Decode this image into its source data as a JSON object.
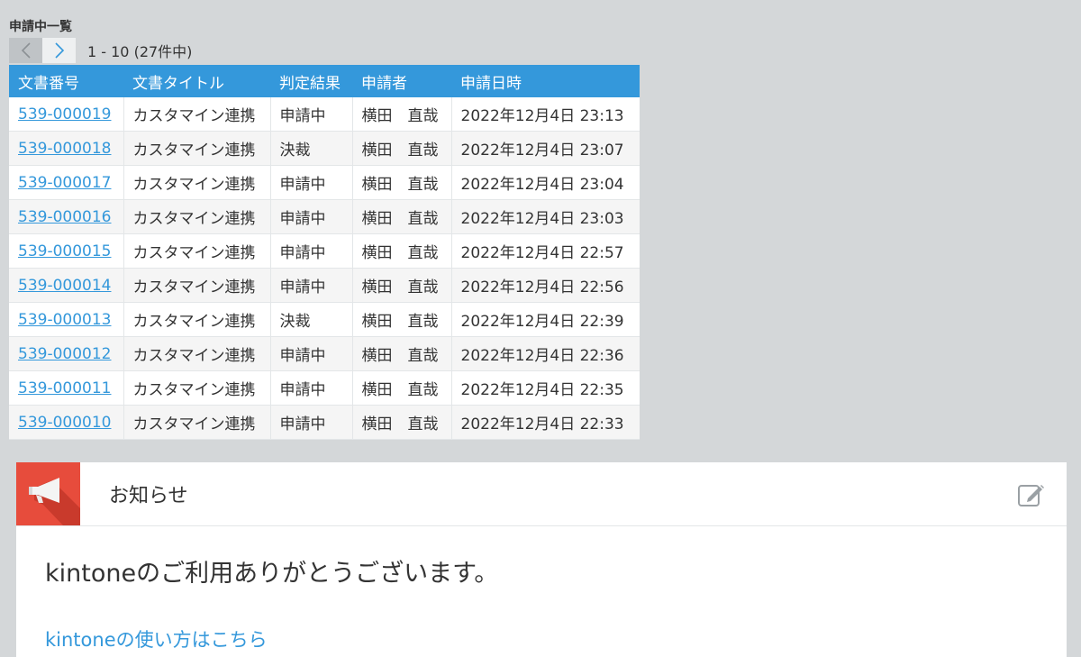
{
  "list": {
    "title": "申請中一覧",
    "pager": {
      "prev_icon": "chevron-left-icon",
      "next_icon": "chevron-right-icon",
      "range": "1 - 10 (27件中)"
    },
    "columns": [
      "文書番号",
      "文書タイトル",
      "判定結果",
      "申請者",
      "申請日時"
    ],
    "rows": [
      [
        "539-000019",
        "カスタマイン連携",
        "申請中",
        "横田　直哉",
        "2022年12月4日 23:13"
      ],
      [
        "539-000018",
        "カスタマイン連携",
        "決裁",
        "横田　直哉",
        "2022年12月4日 23:07"
      ],
      [
        "539-000017",
        "カスタマイン連携",
        "申請中",
        "横田　直哉",
        "2022年12月4日 23:04"
      ],
      [
        "539-000016",
        "カスタマイン連携",
        "申請中",
        "横田　直哉",
        "2022年12月4日 23:03"
      ],
      [
        "539-000015",
        "カスタマイン連携",
        "申請中",
        "横田　直哉",
        "2022年12月4日 22:57"
      ],
      [
        "539-000014",
        "カスタマイン連携",
        "申請中",
        "横田　直哉",
        "2022年12月4日 22:56"
      ],
      [
        "539-000013",
        "カスタマイン連携",
        "決裁",
        "横田　直哉",
        "2022年12月4日 22:39"
      ],
      [
        "539-000012",
        "カスタマイン連携",
        "申請中",
        "横田　直哉",
        "2022年12月4日 22:36"
      ],
      [
        "539-000011",
        "カスタマイン連携",
        "申請中",
        "横田　直哉",
        "2022年12月4日 22:35"
      ],
      [
        "539-000010",
        "カスタマイン連携",
        "申請中",
        "横田　直哉",
        "2022年12月4日 22:33"
      ]
    ]
  },
  "notice": {
    "icon": "megaphone-icon",
    "title": "お知らせ",
    "edit_icon": "edit-icon",
    "message": "kintoneのご利用ありがとうございます。",
    "link": "kintoneの使い方はこちら"
  },
  "colors": {
    "background": "#d4d7d9",
    "header_blue": "#3498db",
    "link_blue": "#3498db",
    "notice_red": "#e74c3c"
  }
}
